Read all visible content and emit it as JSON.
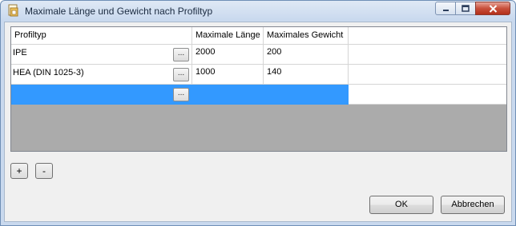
{
  "window": {
    "title": "Maximale Länge und Gewicht nach Profiltyp"
  },
  "grid": {
    "headers": [
      "Profiltyp",
      "Maximale Länge",
      "Maximales Gewicht",
      ""
    ],
    "rows": [
      {
        "profiltyp": "IPE",
        "max_laenge": "2000",
        "max_gewicht": "200"
      },
      {
        "profiltyp": "HEA (DIN 1025-3)",
        "max_laenge": "1000",
        "max_gewicht": "140"
      },
      {
        "profiltyp": "",
        "max_laenge": "",
        "max_gewicht": ""
      }
    ],
    "ellipsis_label": "...",
    "selected_row": 2
  },
  "buttons": {
    "add": "+",
    "remove": "-",
    "ok": "OK",
    "cancel": "Abbrechen"
  },
  "colors": {
    "selection": "#3399ff",
    "grid_background": "#ababab",
    "dialog_background": "#f0f0f0"
  }
}
